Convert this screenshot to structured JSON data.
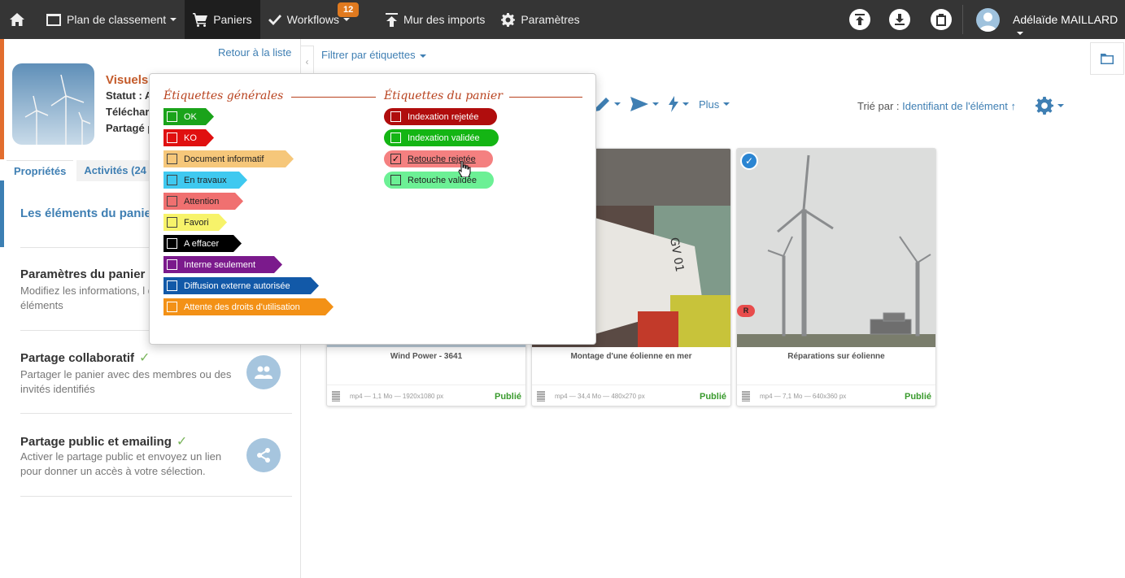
{
  "topbar": {
    "home_label": "",
    "plan_label": "Plan de classement",
    "paniers_label": "Paniers",
    "workflows_label": "Workflows",
    "workflows_badge": "12",
    "imports_label": "Mur des imports",
    "params_label": "Paramètres",
    "user_name": "Adélaïde MAILLARD"
  },
  "left": {
    "back_link": "Retour à la liste",
    "cart_title": "Visuels",
    "meta_status": "Statut : A",
    "meta_download": "Téléchar",
    "meta_shared": "Partagé p",
    "tabs": [
      "Propriétés",
      "Activités (24"
    ],
    "elements_title": "Les éléments du panie",
    "sections": [
      {
        "title": "Paramètres du panier",
        "desc": "Modifiez les informations, l d'affichage des éléments"
      },
      {
        "title": "Partage collaboratif",
        "desc": "Partager le panier avec des membres ou des invités identifiés",
        "check": "✓"
      },
      {
        "title": "Partage public et emailing",
        "desc": "Activer le partage public et envoyez un lien pour donner un accès à votre sélection.",
        "check": "✓"
      }
    ]
  },
  "main": {
    "filter_label": "Filtrer par étiquettes",
    "plus_label": "Plus",
    "sort_prefix": "Trié par :",
    "sort_value": "Identifiant de l'élément ↑"
  },
  "cards": [
    {
      "title": "Wind Power - 3641",
      "meta": "mp4 — 1,1 Mo — 1920x1080 px",
      "status": "Publié"
    },
    {
      "title": "Montage d'une éolienne en mer",
      "meta": "mp4 — 34,4 Mo — 480x270 px",
      "status": "Publié"
    },
    {
      "title": "Réparations sur éolienne",
      "meta": "mp4 — 7,1 Mo — 640x360 px",
      "status": "Publié",
      "badge": "R"
    }
  ],
  "dropdown": {
    "general_title": "Étiquettes générales",
    "cart_title": "Étiquettes du panier",
    "general_tags": [
      {
        "label": "OK",
        "color": "#1aa31a"
      },
      {
        "label": "KO",
        "color": "#e01010"
      },
      {
        "label": "Document informatif",
        "color": "#f6c77a"
      },
      {
        "label": "En travaux",
        "color": "#3fc9f0"
      },
      {
        "label": "Attention",
        "color": "#f07070"
      },
      {
        "label": "Favori",
        "color": "#f7f36a"
      },
      {
        "label": "A effacer",
        "color": "#000000"
      },
      {
        "label": "Interne seulement",
        "color": "#7b1a8c"
      },
      {
        "label": "Diffusion externe autorisée",
        "color": "#1259a8"
      },
      {
        "label": "Attente des droits d'utilisation",
        "color": "#f39116"
      }
    ],
    "cart_tags": [
      {
        "label": "Indexation rejetée",
        "color": "#b00d0d"
      },
      {
        "label": "Indexation validée",
        "color": "#14b514"
      },
      {
        "label": "Retouche rejetée",
        "color": "#f48080",
        "checked": "✓"
      },
      {
        "label": "Retouche validée",
        "color": "#6cf095"
      }
    ]
  }
}
